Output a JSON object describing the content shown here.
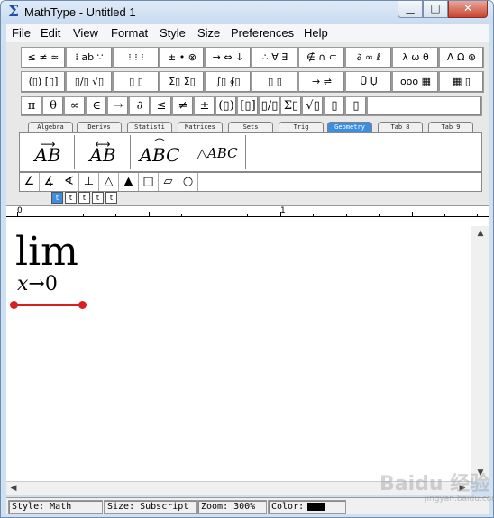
{
  "window": {
    "title": "MathType - Untitled 1",
    "min_label": "▁",
    "max_label": "□",
    "close_label": "✕",
    "app_icon": "Σ"
  },
  "menu": [
    "File",
    "Edit",
    "View",
    "Format",
    "Style",
    "Size",
    "Preferences",
    "Help"
  ],
  "palette_row1": [
    "≤ ≠ ≈",
    "⁞ ab ∵",
    "⁝ ⁝ ⁝",
    "± • ⊗",
    "→ ⇔ ↓",
    "∴ ∀ ∃",
    "∉ ∩ ⊂",
    "∂ ∞ ℓ",
    "λ ω θ",
    "Λ Ω ⊛"
  ],
  "palette_row2": [
    "(▯) [▯]",
    "▯/▯ √▯",
    "▯ ▯",
    "Σ▯ Σ▯",
    "∫▯ ∮▯",
    "▯ ▯",
    "→ ⇌",
    "Ū Ų",
    "ooo ▦",
    "▦ ▯"
  ],
  "symbols": [
    "π",
    "θ",
    "∞",
    "∈",
    "→",
    "∂",
    "≤",
    "≠",
    "±",
    "(▯)",
    "[▯]",
    "▯/▯",
    "Σ▯",
    "√▯",
    "▯",
    "▯"
  ],
  "tabs": [
    "Algebra",
    "Derivs",
    "Statisti",
    "Matrices",
    "Sets",
    "Trig",
    "Geometry",
    "Tab 8",
    "Tab 9"
  ],
  "active_tab": "Geometry",
  "templates": [
    "AB",
    "AB",
    "ABC",
    "△ABC"
  ],
  "shapes": [
    "∠",
    "∡",
    "∢",
    "⊥",
    "△",
    "▲",
    "□",
    "▱",
    "○"
  ],
  "size_buttons": [
    "t",
    "t",
    "t",
    "t",
    "t"
  ],
  "ruler": {
    "label0": "0",
    "label1": "1"
  },
  "equation": {
    "main": "lim",
    "sub_var": "x",
    "sub_arrow": "→",
    "sub_val": "0"
  },
  "status": {
    "style": "Style: Math",
    "size": "Size: Subscript",
    "zoom": "Zoom: 300%",
    "color": "Color:"
  },
  "watermark": "Baidu 经验",
  "watermark_sub": "jingyan.baidu.com"
}
